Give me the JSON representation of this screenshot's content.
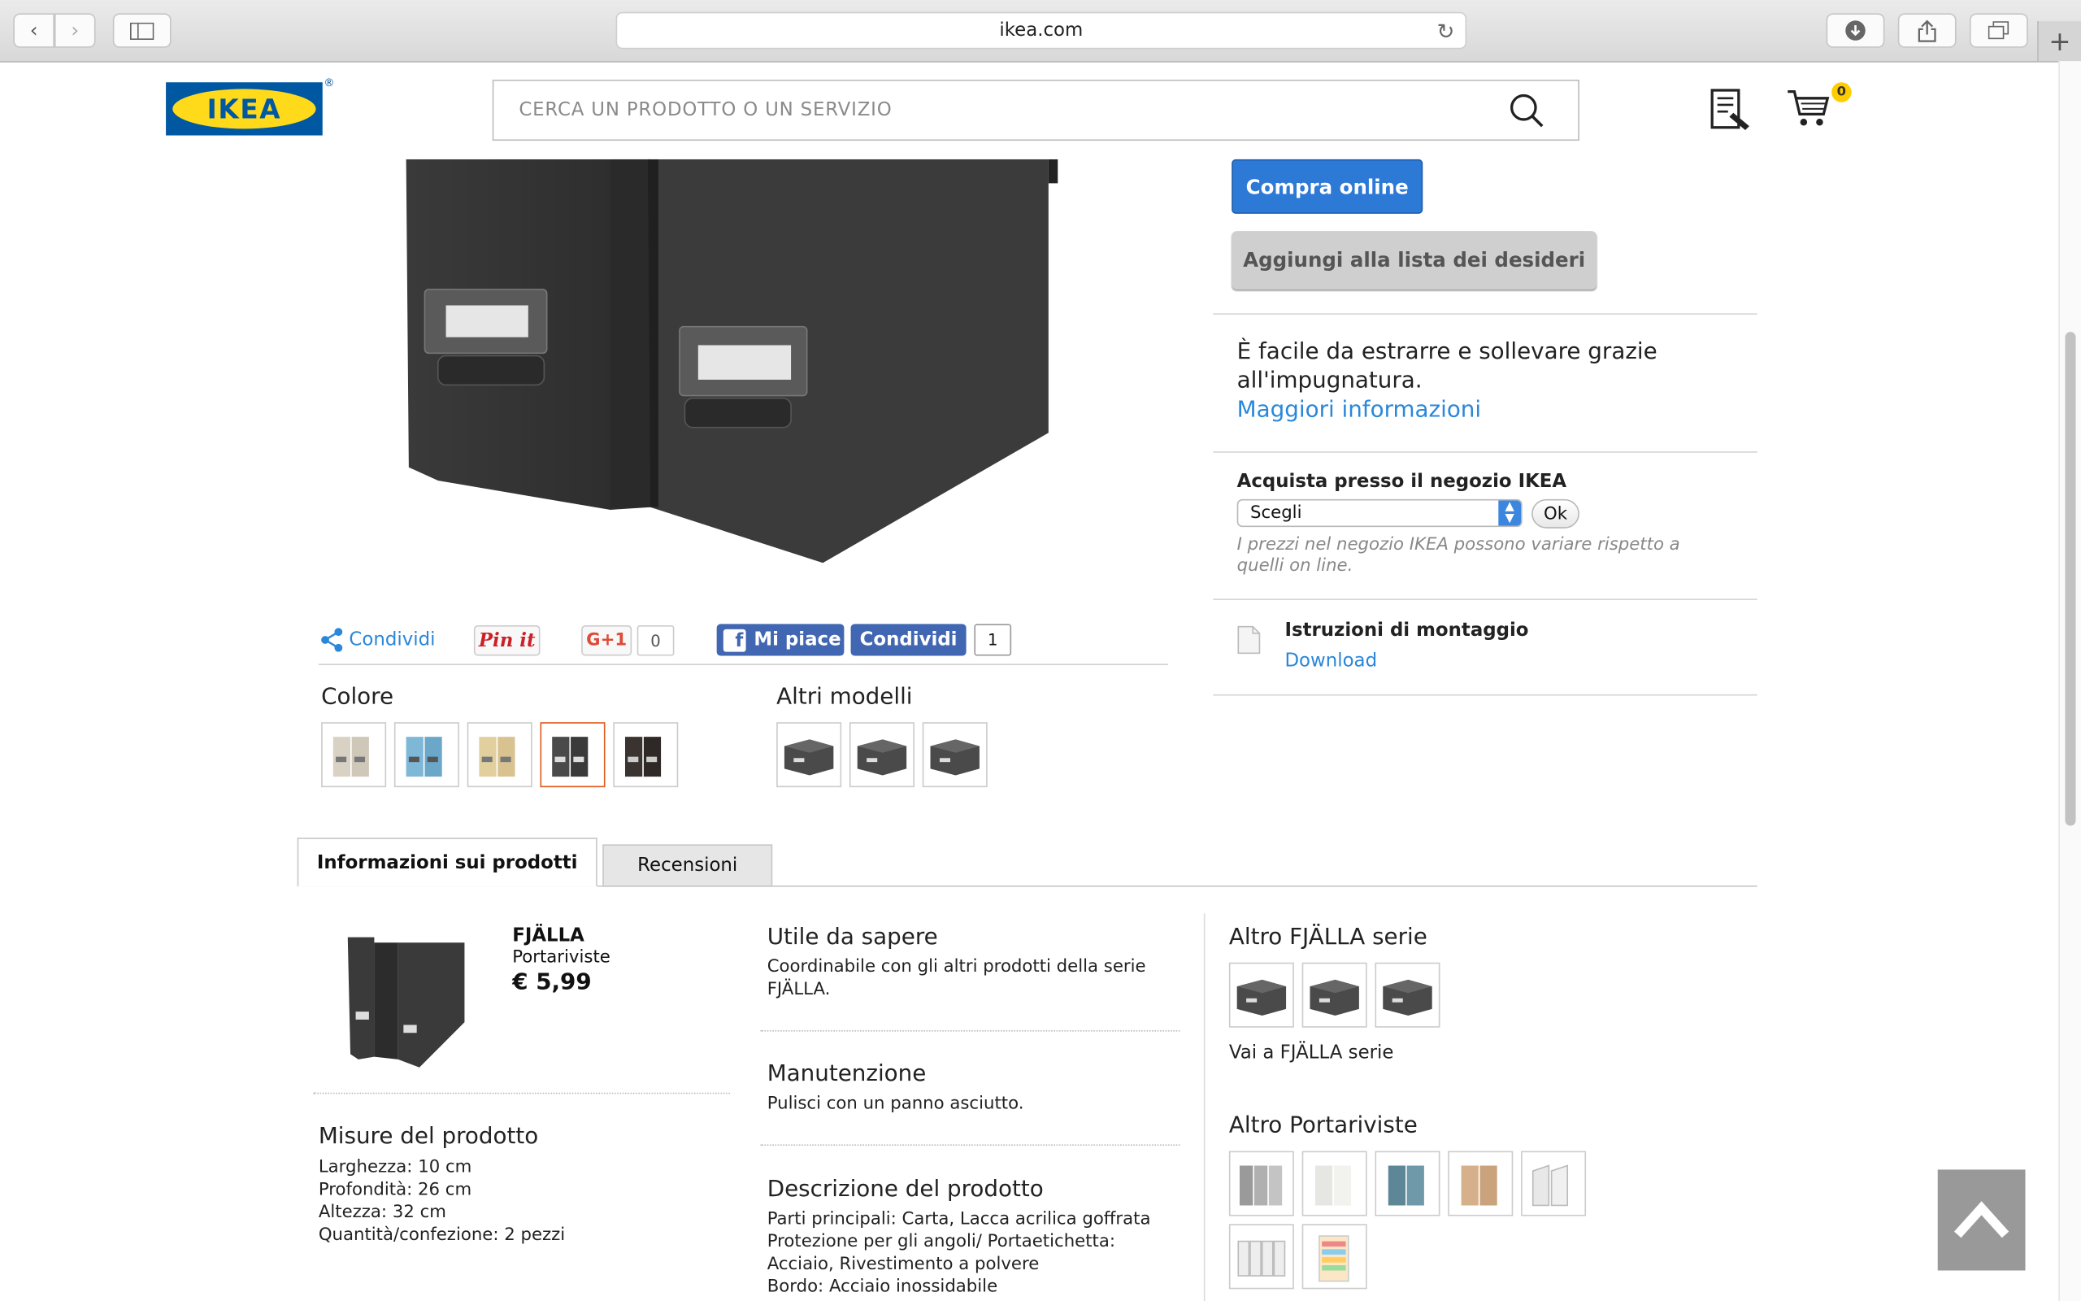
{
  "browser": {
    "url": "ikea.com"
  },
  "header": {
    "logo_text": "IKEA",
    "search_placeholder": "CERCA UN PRODOTTO O UN SERVIZIO",
    "cart_count": "0"
  },
  "buy": {
    "buy_online": "Compra online",
    "add_wishlist": "Aggiungi alla lista dei desideri",
    "description": "È facile da estrarre e sollevare grazie all'impugnatura.",
    "more_info": "Maggiori informazioni",
    "store_title": "Acquista presso il negozio IKEA",
    "store_select": "Scegli",
    "store_ok": "Ok",
    "store_note": "I prezzi nel negozio IKEA possono variare rispetto a quelli on line.",
    "instructions_title": "Istruzioni di montaggio",
    "instructions_link": "Download"
  },
  "share": {
    "share_label": "Condividi",
    "pin_label": "Pin it",
    "gplus_label": "G+1",
    "gplus_count": "0",
    "fb_like": "Mi piace",
    "fb_share": "Condividi",
    "fb_count": "1"
  },
  "variants": {
    "color_title": "Colore",
    "models_title": "Altri modelli",
    "colors": [
      "beige",
      "blue",
      "birch",
      "dark-grey",
      "black-brown"
    ],
    "selected_color_index": 3
  },
  "tabs": {
    "info": "Informazioni sui prodotti",
    "reviews": "Recensioni"
  },
  "product": {
    "name": "FJÄLLA",
    "type": "Portariviste",
    "price": "€ 5,99",
    "measures_title": "Misure del prodotto",
    "measures": [
      "Larghezza: 10 cm",
      "Profondità: 26 cm",
      "Altezza: 32 cm",
      "Quantità/confezione: 2 pezzi"
    ]
  },
  "details": {
    "useful_title": "Utile da sapere",
    "useful_text": "Coordinabile con gli altri prodotti della serie FJÄLLA.",
    "care_title": "Manutenzione",
    "care_text": "Pulisci con un panno asciutto.",
    "desc_title": "Descrizione del prodotto",
    "desc_lines": [
      "Parti principali: Carta, Lacca acrilica goffrata",
      "Protezione per gli angoli/ Portaetichetta:",
      "Acciaio, Rivestimento a polvere",
      "Bordo: Acciaio inossidabile"
    ]
  },
  "related": {
    "series_title": "Altro FJÄLLA serie",
    "series_link": "Vai a FJÄLLA serie",
    "more_title": "Altro Portariviste"
  }
}
